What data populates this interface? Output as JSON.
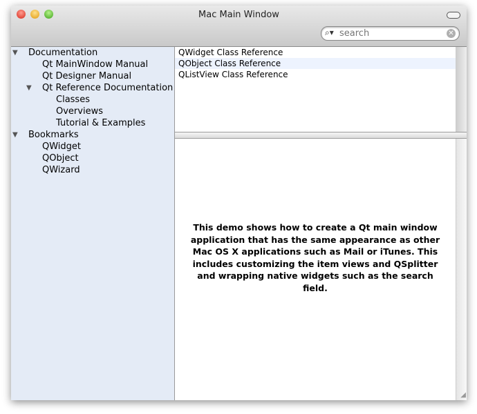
{
  "window": {
    "title": "Mac Main Window"
  },
  "search": {
    "placeholder": "search"
  },
  "sidebar": {
    "items": [
      {
        "label": "Documentation",
        "level": 0,
        "expanded": true
      },
      {
        "label": "Qt MainWindow Manual",
        "level": 1
      },
      {
        "label": "Qt Designer Manual",
        "level": 1
      },
      {
        "label": "Qt Reference Documentation",
        "level": 1,
        "expanded": true
      },
      {
        "label": "Classes",
        "level": 2
      },
      {
        "label": "Overviews",
        "level": 2
      },
      {
        "label": "Tutorial & Examples",
        "level": 2
      },
      {
        "label": "Bookmarks",
        "level": 0,
        "expanded": true
      },
      {
        "label": "QWidget",
        "level": 1
      },
      {
        "label": "QObject",
        "level": 1
      },
      {
        "label": "QWizard",
        "level": 1
      }
    ]
  },
  "list": {
    "items": [
      "QWidget Class Reference",
      "QObject Class Reference",
      "QListView Class Reference"
    ],
    "selected_index": 1
  },
  "content": {
    "text": "This demo shows how to create a Qt main window application that has the same appearance as other Mac OS X applications such as Mail or iTunes. This includes customizing the item views and QSplitter and wrapping native widgets such as the search field."
  },
  "colors": {
    "sidebar": "#e4ebf6",
    "selection": "#edf3fe"
  }
}
